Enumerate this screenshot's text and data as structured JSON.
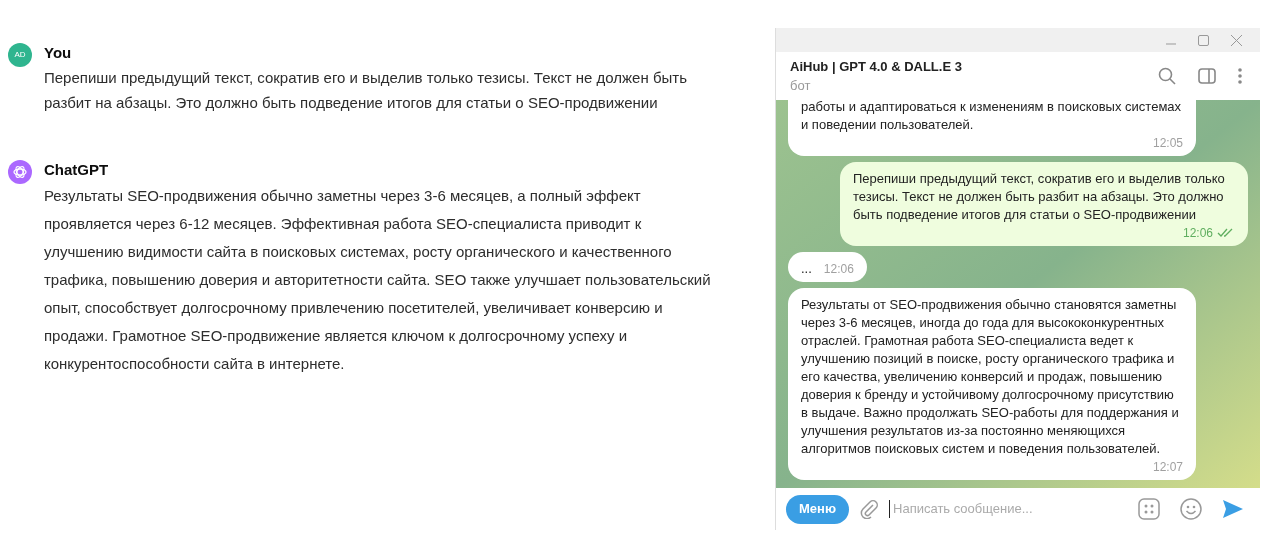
{
  "chat": {
    "messages": [
      {
        "author": "You",
        "avatar": "AD",
        "kind": "user",
        "text": "Перепиши предыдущий текст, сократив его и выделив только тезисы. Текст не должен быть разбит на абзацы. Это должно быть подведение итогов для статьи о SEO-продвижении"
      },
      {
        "author": "ChatGPT",
        "kind": "assistant",
        "text": "Результаты SEO-продвижения обычно заметны через 3-6 месяцев, а полный эффект проявляется через 6-12 месяцев. Эффективная работа SEO-специалиста приводит к улучшению видимости сайта в поисковых системах, росту органического и качественного трафика, повышению доверия и авторитетности сайта. SEO также улучшает пользовательский опыт, способствует долгосрочному привлечению посетителей, увеличивает конверсию и продажи. Грамотное SEO-продвижение является ключом к долгосрочному успеху и конкурентоспособности сайта в интернете."
      }
    ]
  },
  "telegram": {
    "title": "AiHub | GPT 4.0 & DALL.E 3",
    "subtitle": "бот",
    "messages": [
      {
        "kind": "incoming",
        "cut": true,
        "text": "работы и адаптироваться к изменениям в поисковых системах и поведении пользователей.",
        "time": "12:05"
      },
      {
        "kind": "outgoing",
        "text": "Перепиши предыдущий текст, сократив его и выделив только тезисы. Текст не должен быть разбит на абзацы. Это должно быть подведение итогов для статьи о SEO-продвижении",
        "time": "12:06",
        "read": true
      },
      {
        "kind": "incoming",
        "text": "...",
        "time": "12:06"
      },
      {
        "kind": "incoming",
        "text": "Результаты от SEO-продвижения обычно становятся заметны через 3-6 месяцев, иногда до года для высококонкурентных отраслей. Грамотная работа SEO-специалиста ведет к улучшению позиций в поиске, росту органического трафика и его качества, увеличению конверсий и продаж, повышению доверия к бренду и устойчивому долгосрочному присутствию в выдаче. Важно продолжать SEO-работы для поддержания и улучшения результатов из-за постоянно меняющихся алгоритмов поисковых систем и поведения пользователей.",
        "time": "12:07"
      }
    ],
    "menu_button": "Меню",
    "input_placeholder": "Написать сообщение..."
  }
}
